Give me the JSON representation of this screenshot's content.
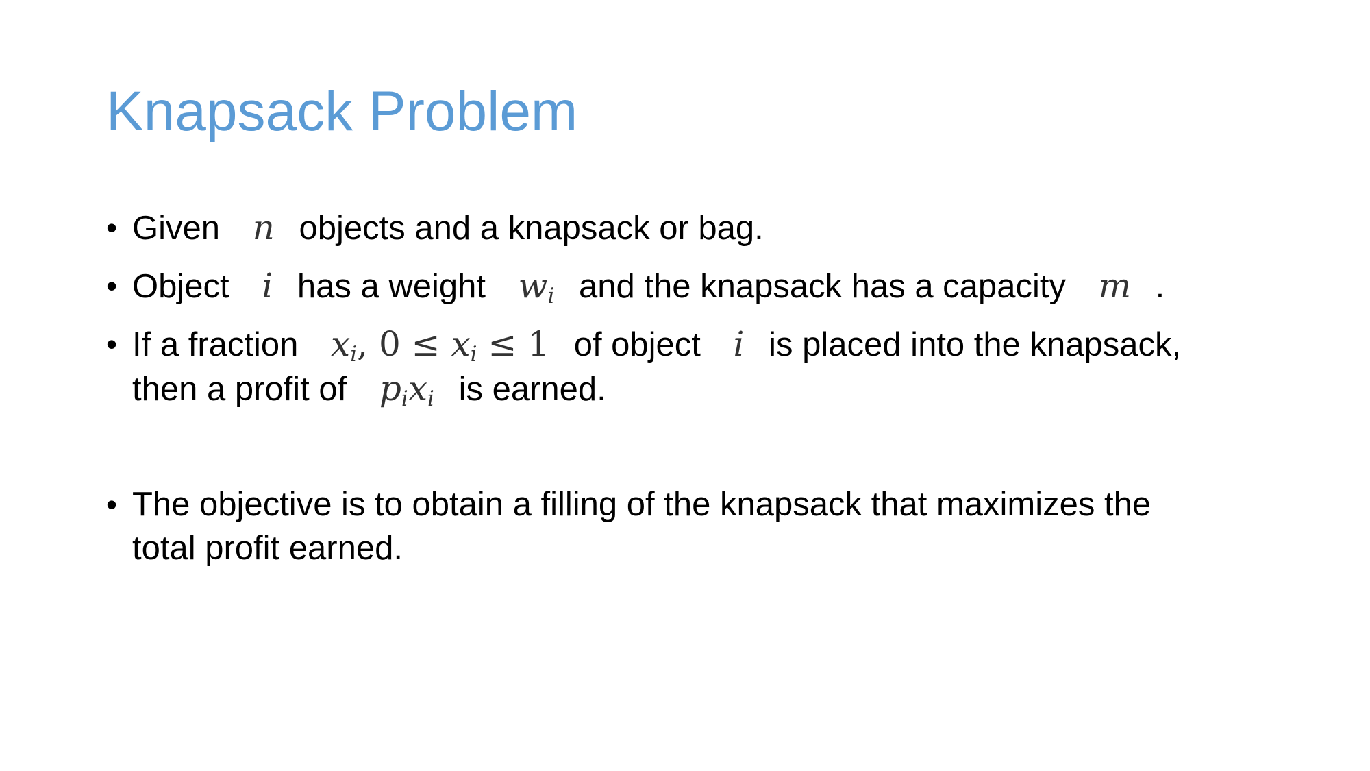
{
  "slide": {
    "title": "Knapsack Problem",
    "bullet_symbol": "•",
    "bullets": [
      {
        "text_1": "Given",
        "math_n": "n",
        "text_2": "objects and a knapsack or bag."
      },
      {
        "text_1": "Object",
        "math_i": "i",
        "text_2": "has a weight",
        "math_w": "w",
        "math_w_sub": "i",
        "text_3": "and the knapsack has a capacity",
        "math_m": "m",
        "text_4": "."
      },
      {
        "text_1": "If a fraction",
        "math_x": "x",
        "math_x_sub": "i",
        "math_constraint_a": ", 0 ≤ ",
        "math_x2": "x",
        "math_x2_sub": "i",
        "math_constraint_b": " ≤ 1",
        "text_2": "of object",
        "math_i": "i",
        "text_3": "is placed into the knapsack,",
        "text_4": "then a profit of",
        "math_p": "p",
        "math_p_sub": "i",
        "math_px": "x",
        "math_px_sub": "i",
        "text_5": "is earned."
      },
      {
        "text_1": "The objective is to obtain a filling of the knapsack that maximizes the",
        "text_2": "total profit earned."
      }
    ]
  }
}
